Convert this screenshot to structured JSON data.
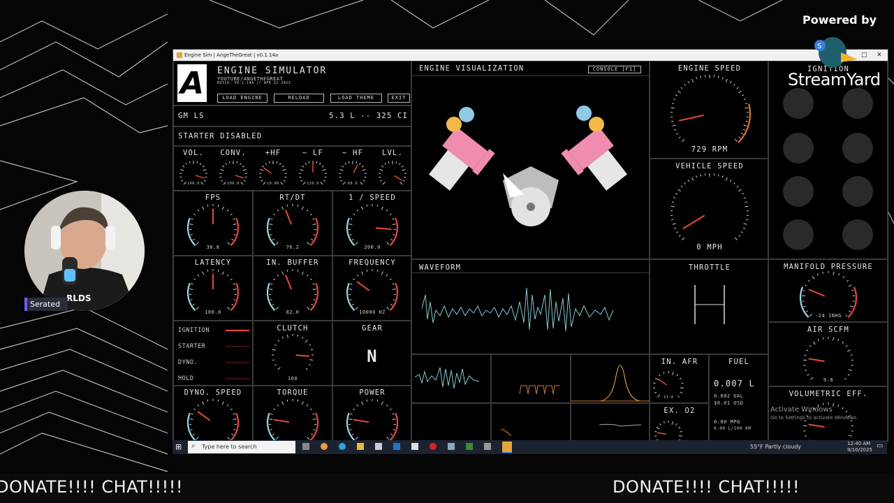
{
  "colors": {
    "accent": "#e8493b",
    "gauge_blue": "#9fd6e8",
    "wave": "#86c9cf",
    "orange": "#d9762c",
    "piston_pink": "#f08cb0",
    "cam_yellow": "#f2b84b",
    "cam_blue": "#8ec9e6"
  },
  "stream": {
    "powered_by": "Powered by",
    "brand": "StreamYard",
    "guest_name": "Serated",
    "ticker_left": "DONATE!!!! CHAT!!!!!",
    "ticker_right": "DONATE!!!! CHAT!!!!!"
  },
  "window": {
    "title": "Engine Sim | AngeTheGreat | v0.1.14a"
  },
  "app": {
    "logo": "A",
    "name": "ENGINE SIMULATOR",
    "sub1": "YOUTUBE/ANGETHEGREAT",
    "sub2": "BUILD: V0.1.14A // APR 22 2023",
    "buttons": [
      "LOAD ENGINE",
      "RELOAD",
      "LOAD THEME",
      "EXIT"
    ],
    "engine_name": "GM LS",
    "engine_spec": "5.3 L -- 325 CI",
    "starter": "STARTER DISABLED",
    "mini_gauges": [
      {
        "label": "VOL.",
        "value": "100.0",
        "level": 0.9
      },
      {
        "label": "CONV.",
        "value": "100.0",
        "level": 0.9
      },
      {
        "label": "+HF",
        "value": "10.00",
        "level": 0.3
      },
      {
        "label": "~ LF",
        "value": "120.0",
        "level": 0.5
      },
      {
        "label": "~ HF",
        "value": "60.0",
        "level": 0.6
      },
      {
        "label": "LVL.",
        "value": "",
        "level": 0.95
      }
    ],
    "row2": [
      {
        "label": "FPS",
        "value": "38.8",
        "level": 0.5
      },
      {
        "label": "RT/DT",
        "value": "76.2",
        "level": 0.42
      },
      {
        "label": "1 / SPEED",
        "value": "200.0",
        "level": 0.85
      }
    ],
    "row3": [
      {
        "label": "LATENCY",
        "value": "100.0",
        "level": 0.5
      },
      {
        "label": "IN. BUFFER",
        "value": "82.0",
        "level": 0.42
      },
      {
        "label": "FREQUENCY",
        "value": "10000 HZ",
        "level": 0.3
      }
    ],
    "status": [
      "IGNITION",
      "STARTER",
      "DYNO.",
      "HOLD"
    ],
    "clutch": {
      "label": "CLUTCH",
      "value": "100",
      "level": 0.85
    },
    "gear": {
      "label": "GEAR",
      "value": "N"
    },
    "row5": [
      {
        "label": "DYNO. SPEED",
        "level": 0.3
      },
      {
        "label": "TORQUE",
        "level": 0.2
      },
      {
        "label": "POWER",
        "level": 0.2
      }
    ],
    "viz": {
      "title": "ENGINE VISUALIZATION",
      "console": "CONSOLE [F1]"
    },
    "waveform": {
      "title": "WAVEFORM"
    },
    "engine_speed": {
      "label": "ENGINE SPEED",
      "value": "729 RPM",
      "level": 0.12
    },
    "vehicle_speed": {
      "label": "VEHICLE SPEED",
      "value": "0 MPH",
      "level": 0.05
    },
    "throttle": {
      "label": "THROTTLE"
    },
    "ignition": {
      "label": "IGNITION"
    },
    "manifold": {
      "label": "MANIFOLD PRESSURE",
      "value": "-24 INHG",
      "level": 0.25
    },
    "air": {
      "label": "AIR SCFM",
      "value": "9.8",
      "level": 0.2
    },
    "vol_eff": {
      "label": "VOLUMETRIC EFF.",
      "level": 0.2
    },
    "afr": {
      "label": "IN. AFR",
      "value": "13.4",
      "level": 0.3
    },
    "ex_o2": {
      "label": "EX. O2",
      "level": 0.2
    },
    "fuel": {
      "label": "FUEL",
      "value": "0.007 L",
      "l1": "0.002 GAL",
      "l2": "$0.01 USD",
      "l3": "0.00 MPG",
      "l4": "0.00 L/100 KM"
    }
  },
  "taskbar": {
    "search": "Type here to search",
    "weather": "55°F  Partly cloudy",
    "time": "12:40 AM",
    "date": "9/10/2025"
  },
  "watermark": {
    "l1": "Activate Windows",
    "l2": "Go to Settings to activate Windows."
  }
}
